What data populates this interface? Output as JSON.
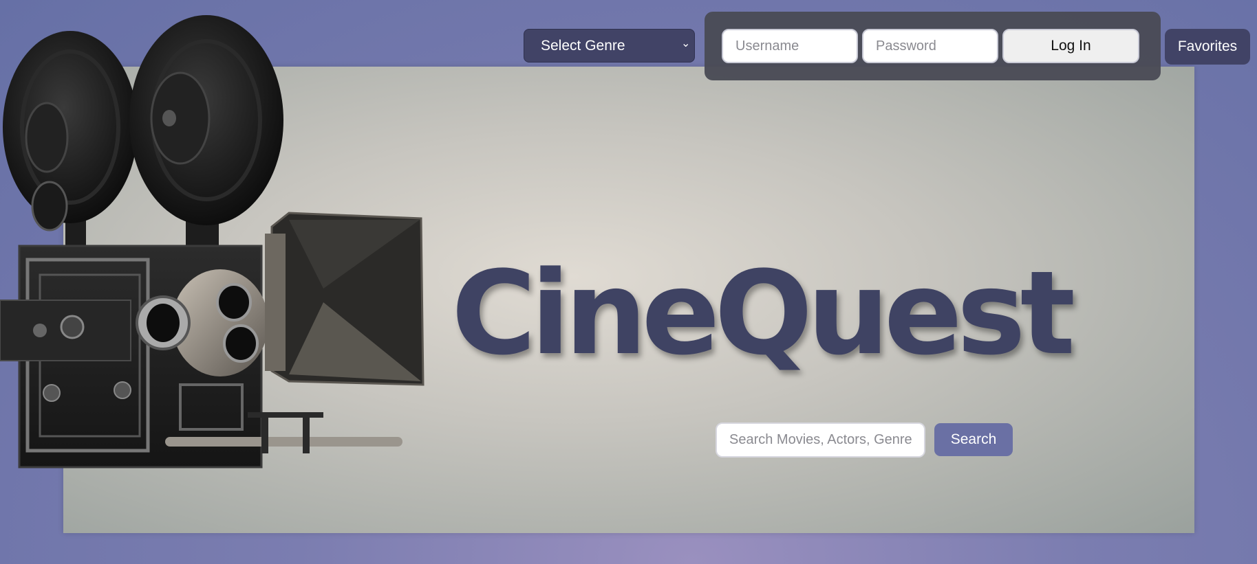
{
  "brand": {
    "title": "CineQuest"
  },
  "nav": {
    "genre_select": {
      "selected": "Select Genre",
      "options": [
        "Select Genre"
      ]
    }
  },
  "login": {
    "username_placeholder": "Username",
    "password_placeholder": "Password",
    "login_label": "Log In"
  },
  "favorites_label": "Favorites",
  "search": {
    "placeholder": "Search Movies, Actors, Genre",
    "button_label": "Search"
  },
  "colors": {
    "brand_text": "#3f4363",
    "button_dark": "#414366",
    "button_accent": "#6a70a4",
    "login_panel": "#4a4b55"
  },
  "icons": {
    "hero_image": "vintage-film-camera",
    "select_arrow": "chevron-down-icon"
  }
}
